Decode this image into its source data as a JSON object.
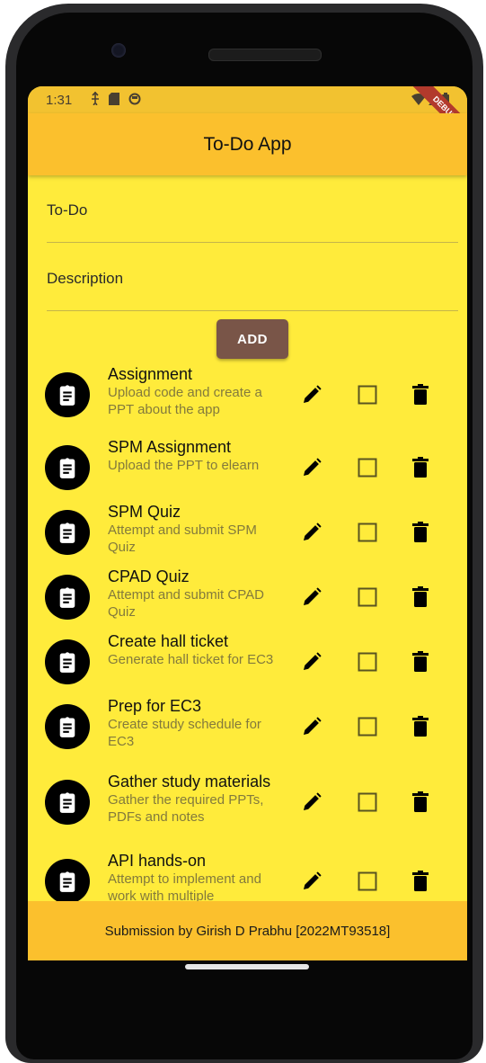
{
  "status_bar": {
    "time": "1:31"
  },
  "debug_banner": "DEBUG",
  "app_bar": {
    "title": "To-Do App"
  },
  "form": {
    "todo_placeholder": "To-Do",
    "description_placeholder": "Description",
    "add_label": "ADD"
  },
  "todos": [
    {
      "title": "Assignment",
      "description": "Upload code and create a PPT about the app"
    },
    {
      "title": "SPM Assignment",
      "description": "Upload the PPT to elearn"
    },
    {
      "title": "SPM Quiz",
      "description": "Attempt and submit SPM Quiz"
    },
    {
      "title": "CPAD Quiz",
      "description": "Attempt and submit CPAD Quiz"
    },
    {
      "title": "Create hall ticket",
      "description": "Generate hall ticket for EC3"
    },
    {
      "title": "Prep for EC3",
      "description": "Create study schedule for EC3"
    },
    {
      "title": "Gather study materials",
      "description": "Gather the required PPTs, PDFs and notes"
    },
    {
      "title": "API hands-on",
      "description": "Attempt to implement and work with multiple"
    }
  ],
  "footer": {
    "text": "Submission by Girish D Prabhu [2022MT93518]"
  },
  "icons": {
    "avatar": "assignment-icon",
    "edit": "pencil-icon",
    "complete": "checkbox-icon",
    "delete": "trash-icon"
  },
  "colors": {
    "background": "#ffeb3b",
    "app_bar": "#fbc02d",
    "add_button": "#795548",
    "description_text": "#837a3c"
  }
}
